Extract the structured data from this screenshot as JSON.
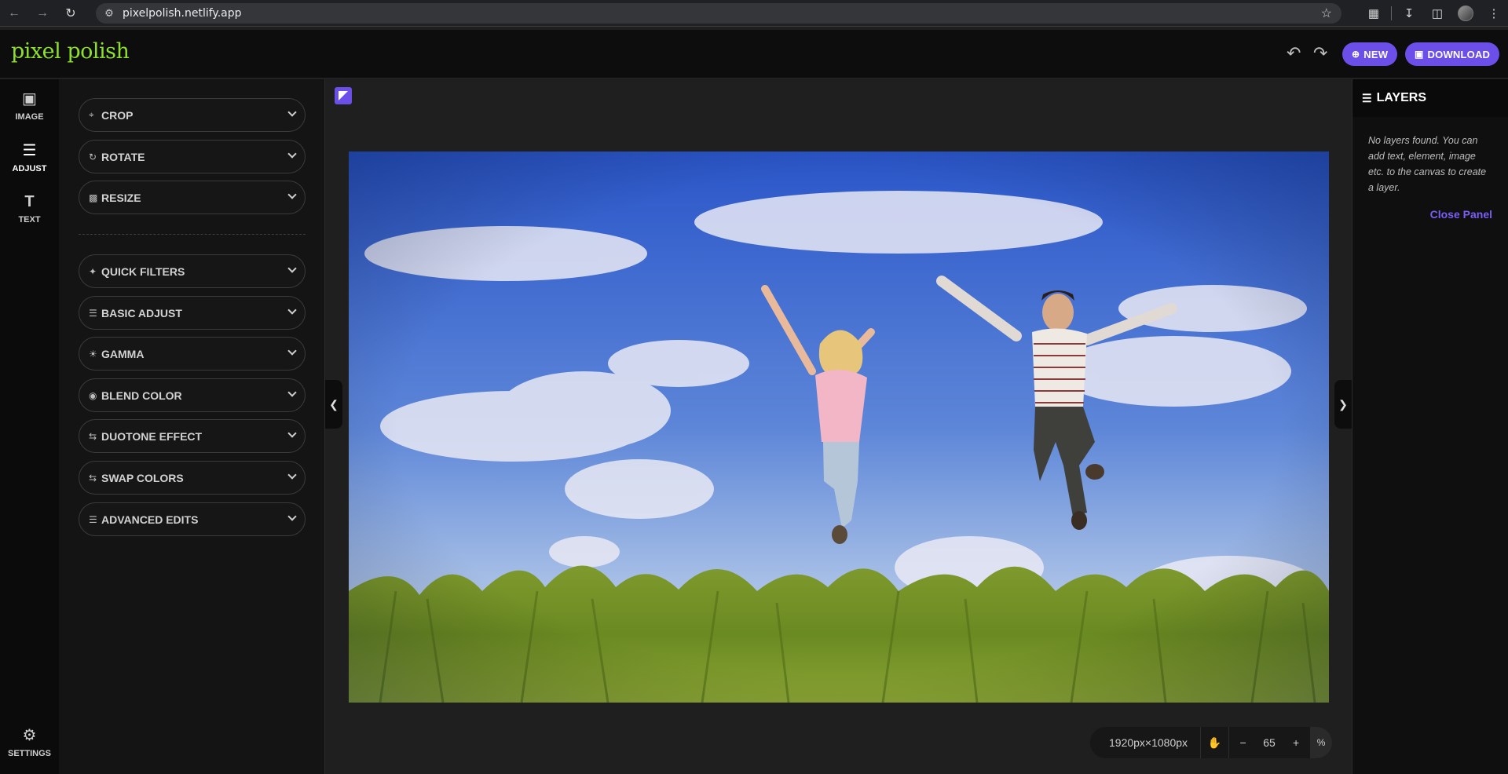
{
  "browser": {
    "url": "pixelpolish.netlify.app"
  },
  "app": {
    "logo": "pixel polish",
    "new_label": "NEW",
    "download_label": "DOWNLOAD"
  },
  "rail": {
    "items": [
      {
        "label": "IMAGE",
        "icon": "image-icon"
      },
      {
        "label": "ADJUST",
        "icon": "sliders-icon",
        "active": true
      },
      {
        "label": "TEXT",
        "icon": "text-icon"
      }
    ],
    "settings_label": "SETTINGS"
  },
  "panel": {
    "top_sections": [
      {
        "label": "CROP",
        "icon": "crop-icon"
      },
      {
        "label": "ROTATE",
        "icon": "rotate-icon"
      },
      {
        "label": "RESIZE",
        "icon": "resize-icon"
      }
    ],
    "sections": [
      {
        "label": "QUICK FILTERS",
        "icon": "magic-wand-icon"
      },
      {
        "label": "BASIC ADJUST",
        "icon": "sliders-icon"
      },
      {
        "label": "GAMMA",
        "icon": "sun-icon"
      },
      {
        "label": "BLEND COLOR",
        "icon": "palette-icon"
      },
      {
        "label": "DUOTONE EFFECT",
        "icon": "swap-icon"
      },
      {
        "label": "SWAP COLORS",
        "icon": "swap-icon"
      },
      {
        "label": "ADVANCED EDITS",
        "icon": "sliders-icon"
      }
    ]
  },
  "canvas": {
    "dimensions": "1920px×1080px",
    "zoom": "65",
    "zoom_unit": "%"
  },
  "layers": {
    "title": "LAYERS",
    "empty_message": "No layers found. You can add text, element, image etc. to the canvas to create a layer.",
    "close_label": "Close Panel"
  },
  "colors": {
    "accent": "#6b4fe8",
    "logo": "#8ee02b",
    "link": "#7b5ef5"
  }
}
